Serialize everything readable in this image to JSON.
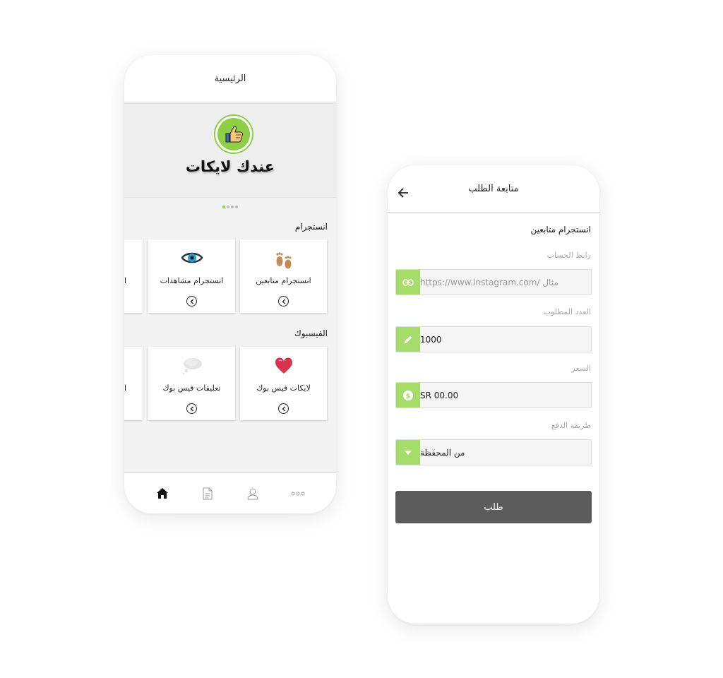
{
  "home": {
    "header_title": "الرئيسية",
    "banner_title": "عندك لايكات",
    "carousel": {
      "count": 4,
      "active_index": 0
    },
    "sections": [
      {
        "title": "انستجرام",
        "cards": [
          {
            "label": "انستجرام متابعين",
            "icon": "footprints-icon"
          },
          {
            "label": "انستجرام مشاهدات",
            "icon": "eye-icon"
          },
          {
            "label": "ا",
            "icon": ""
          }
        ]
      },
      {
        "title": "الفيسبوك",
        "cards": [
          {
            "label": "لايكات فيس بوك",
            "icon": "heart-icon"
          },
          {
            "label": "تعليقات فيس بوك",
            "icon": "speech-bubble-icon"
          },
          {
            "label": "ا",
            "icon": ""
          }
        ]
      }
    ],
    "tabbar": [
      "home-icon",
      "document-icon",
      "profile-icon",
      "more-icon"
    ]
  },
  "order": {
    "header_title": "متابعة الطلب",
    "service_title": "انستجرام متابعين",
    "account_link": {
      "label": "رابط الحساب",
      "placeholder": "مثال /https://www.instagram.com",
      "icon": "link-icon"
    },
    "quantity": {
      "label": "العدد المطلوب",
      "value": "1000",
      "icon": "pencil-icon"
    },
    "price": {
      "label": "السعر",
      "value": "SR 00.00",
      "icon": "dollar-icon"
    },
    "payment_method": {
      "label": "طريقة الدفع",
      "value": "من المحفظة",
      "icon": "caret-down-icon"
    },
    "submit_label": "طلب"
  },
  "colors": {
    "accent": "#a6dc6a",
    "button": "#5c5c5c"
  }
}
